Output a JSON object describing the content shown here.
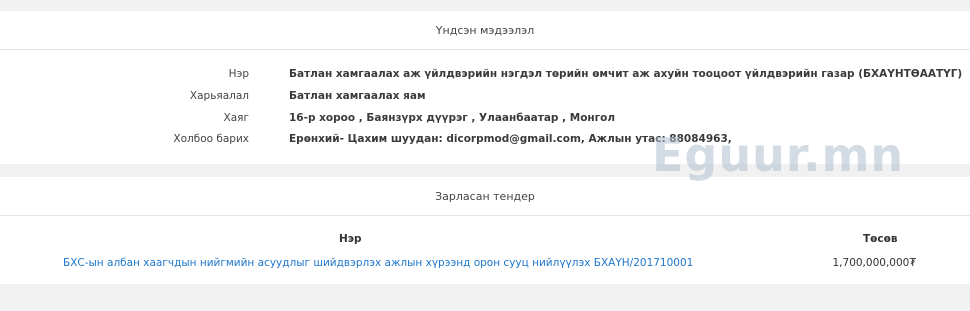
{
  "info_panel": {
    "heading": "Үндсэн мэдээлэл",
    "rows": [
      {
        "label": "Нэр",
        "value": "Батлан хамгаалах аж үйлдвэрийн нэгдэл төрийн өмчит аж ахуйн тооцоот үйлдвэрийн газар (БХАҮНТӨААТҮГ)"
      },
      {
        "label": "Харьяалал",
        "value": "Батлан хамгаалах яам"
      },
      {
        "label": "Хаяг",
        "value": "16-р хороо , Баянзүрх дүүрэг , Улаанбаатар , Монгол"
      },
      {
        "label": "Холбоо барих",
        "value": "Ерөнхий- Цахим шуудан: dicorpmod@gmail.com, Ажлын утас: 88084963,"
      }
    ]
  },
  "tender_panel": {
    "heading": "Зарласан тендер",
    "columns": {
      "name": "Нэр",
      "budget": "Төсөв"
    },
    "rows": [
      {
        "name": "БХС-ын албан хаагчдын нийгмийн асуудлыг шийдвэрлэх ажлын хүрээнд орон сууц нийлүүлэх БХАҮН/201710001",
        "budget": "1,700,000,000₮"
      }
    ]
  },
  "watermark": "Eguur.mn"
}
